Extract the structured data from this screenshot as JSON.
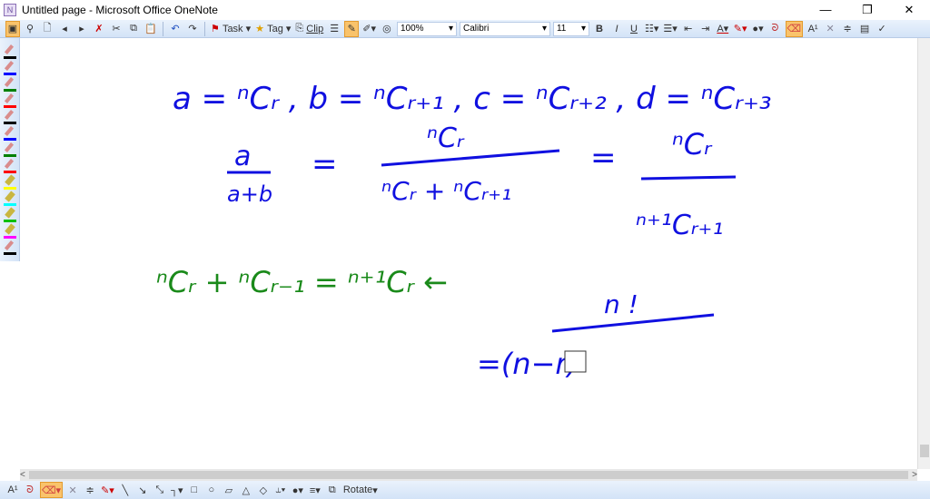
{
  "window": {
    "title": "Untitled page - Microsoft Office OneNote",
    "app_icon": "N",
    "minimize": "—",
    "restore": "❐",
    "close": "✕"
  },
  "toolbar": {
    "task": "Task",
    "tag": "Tag",
    "clip": "Clip",
    "zoom": "100%",
    "font": "Calibri",
    "size": "11",
    "bold": "B",
    "italic": "I",
    "underline": "U",
    "superscript": "A¹"
  },
  "bottom_toolbar": {
    "rotate": "Rotate",
    "superscript": "A¹"
  },
  "pens": [
    "#000000",
    "#0000ff",
    "#008000",
    "#ff0000",
    "#000000",
    "#0000ff",
    "#008000",
    "#ff0000",
    "#ffff00",
    "#00ffff",
    "#00c000",
    "#ff00ff",
    "#000000"
  ],
  "ink": {
    "line1": "a = ⁿCᵣ ,  b = ⁿCᵣ₊₁ ,  c = ⁿCᵣ₊₂ ,  d = ⁿCᵣ₊₃",
    "frac1_num": "a",
    "frac1_den": "a+b",
    "eq": "=",
    "frac2_num": "ⁿCᵣ",
    "frac2_den": "ⁿCᵣ + ⁿCᵣ₊₁",
    "frac3_num": "ⁿCᵣ",
    "frac3_den": "ⁿ⁺¹Cᵣ₊₁",
    "green_identity": "ⁿCᵣ + ⁿCᵣ₋₁ = ⁿ⁺¹Cᵣ ←",
    "frac4_num": "n !",
    "frac4_den": "=(n−r)"
  },
  "colors": {
    "blue_ink": "#1010e0",
    "green_ink": "#1a8a1a"
  }
}
